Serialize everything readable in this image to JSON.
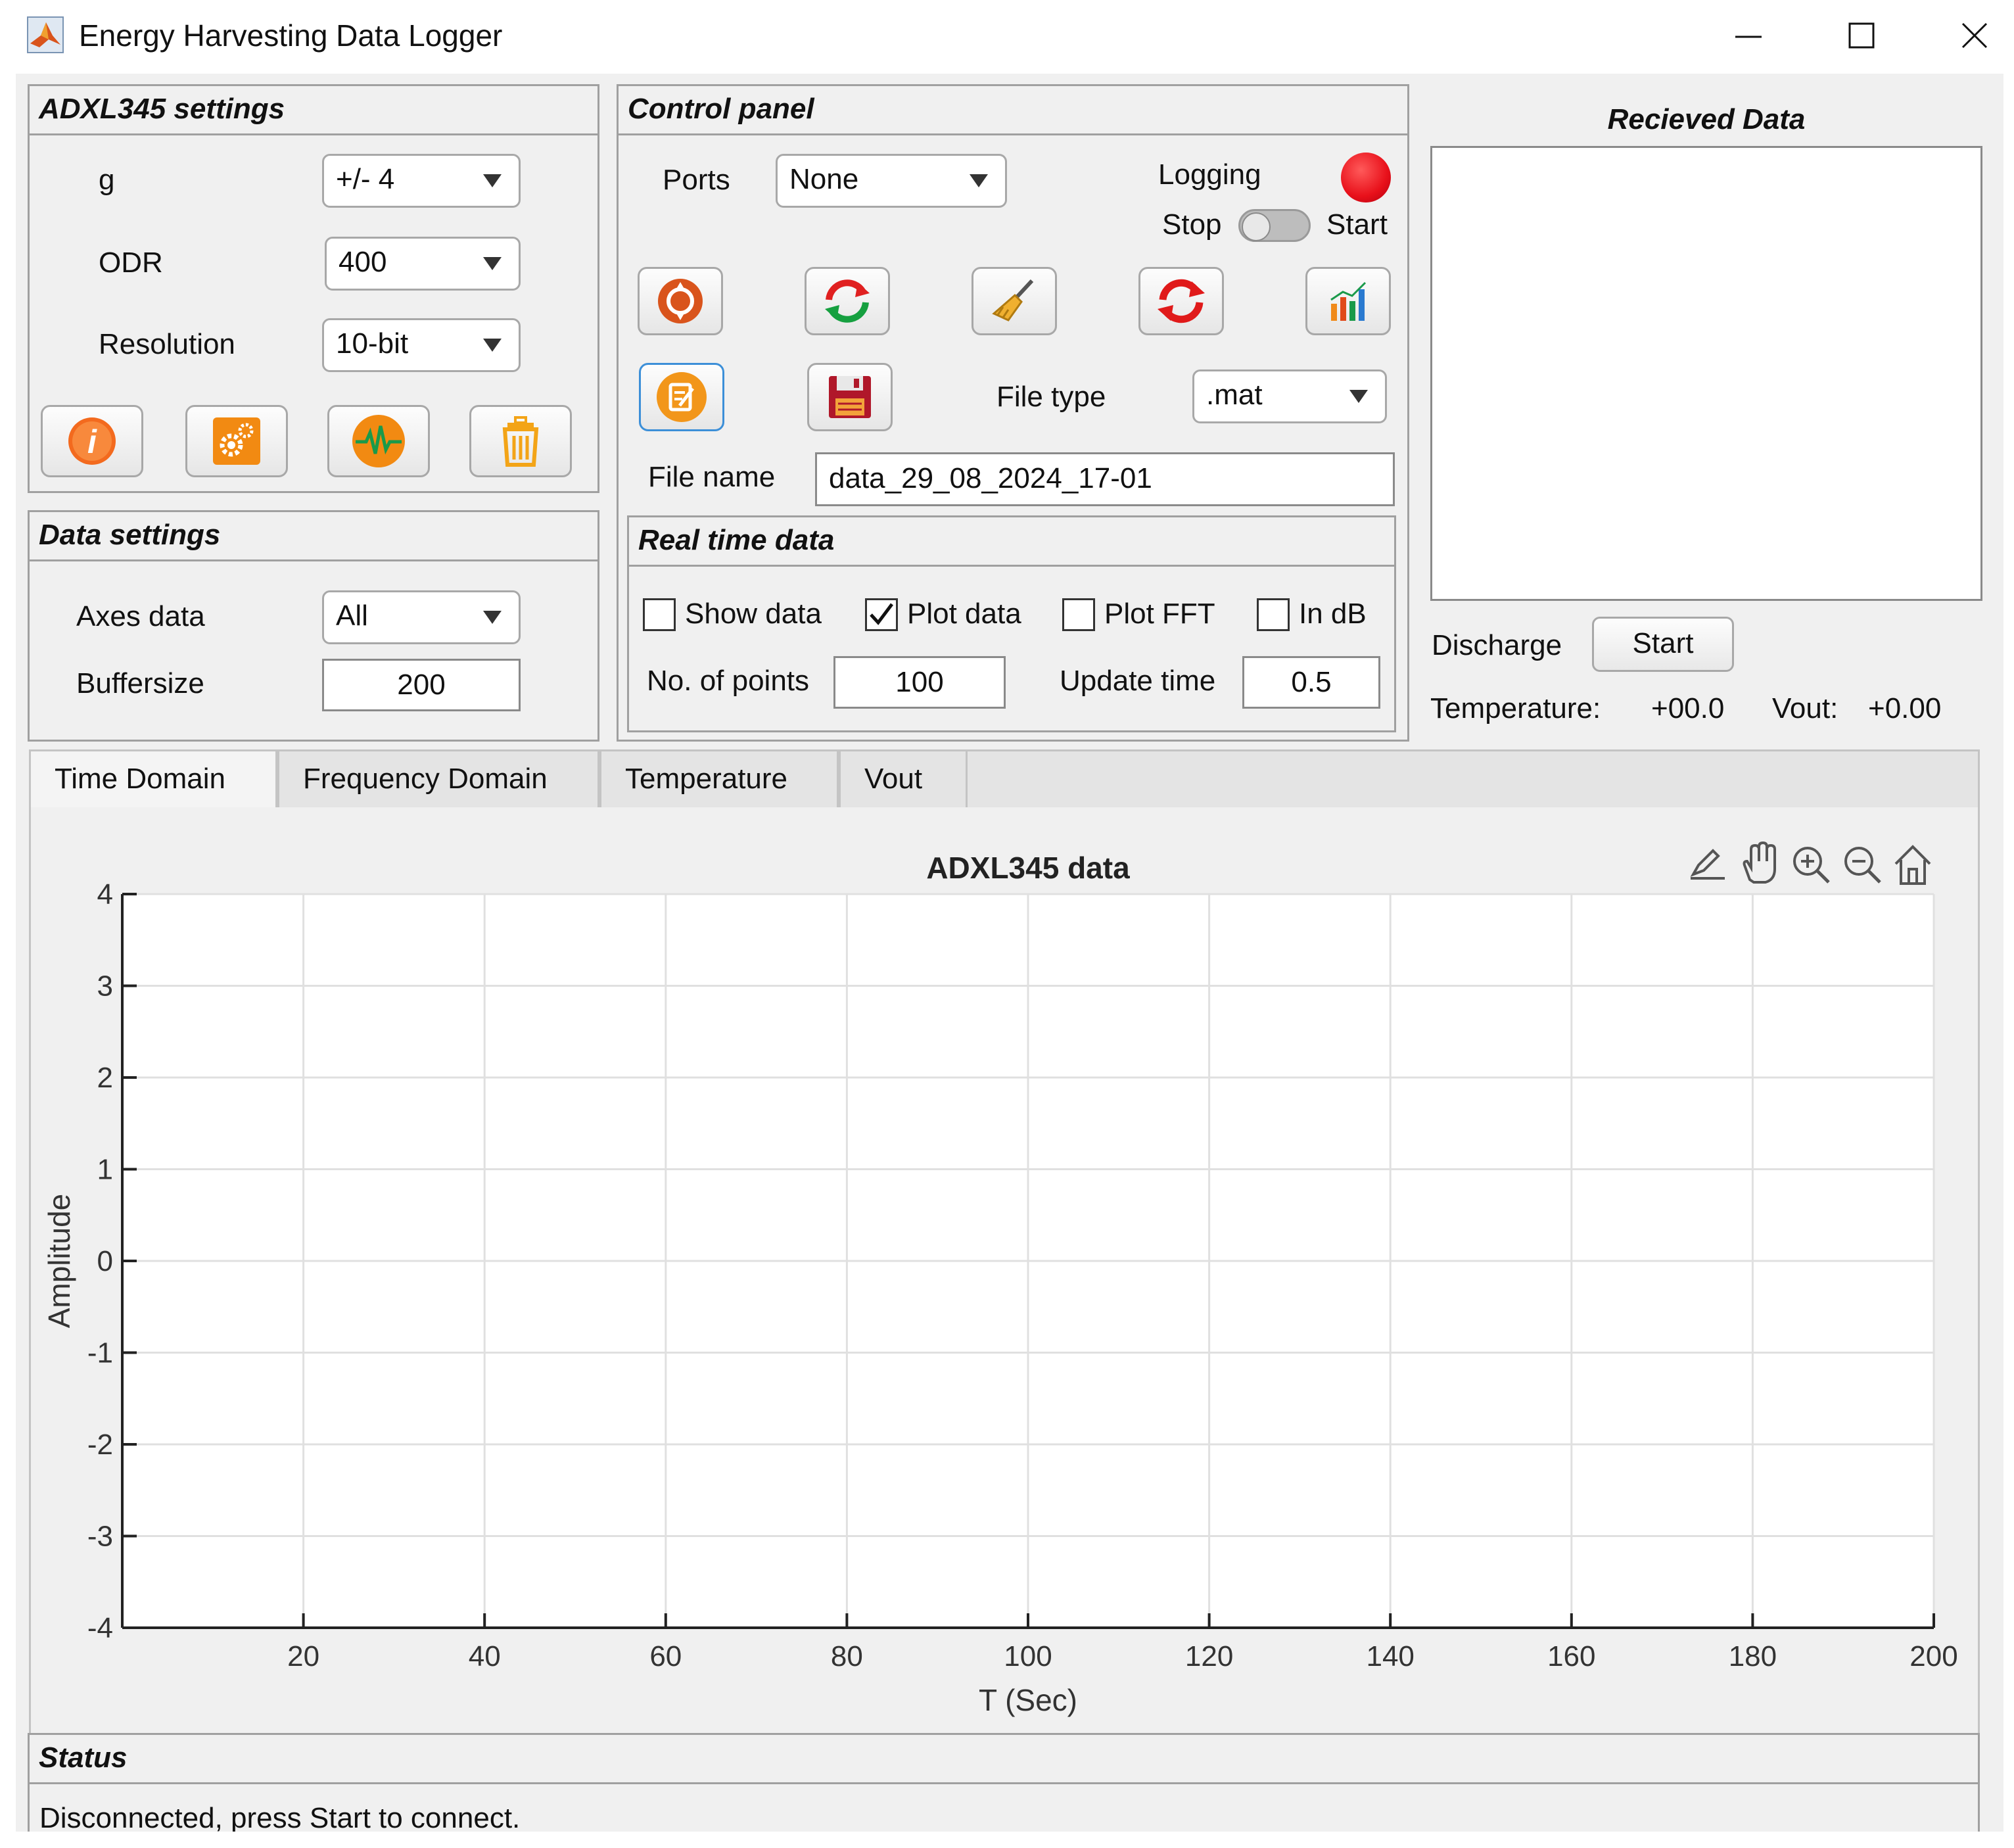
{
  "window": {
    "title": "Energy Harvesting Data Logger",
    "icon": "matlab-icon"
  },
  "adxl": {
    "title": "ADXL345 settings",
    "g_label": "g",
    "g_value": "+/- 4",
    "odr_label": "ODR",
    "odr_value": "400",
    "res_label": "Resolution",
    "res_value": "10-bit",
    "buttons": [
      "info-icon",
      "settings-gears-icon",
      "pulse-icon",
      "trash-icon"
    ]
  },
  "data_settings": {
    "title": "Data settings",
    "axes_label": "Axes data",
    "axes_value": "All",
    "buffer_label": "Buffersize",
    "buffer_value": "200"
  },
  "control": {
    "title": "Control panel",
    "ports_label": "Ports",
    "ports_value": "None",
    "logging_label": "Logging",
    "stop_label": "Stop",
    "start_label": "Start",
    "logging_lamp_color": "#e8101a",
    "file_type_label": "File type",
    "file_type_value": ".mat",
    "file_name_label": "File name",
    "file_name_value": "data_29_08_2024_17-01",
    "icons_row1": [
      "connect-icon",
      "refresh-green-icon",
      "broom-icon",
      "reset-red-icon",
      "bar-chart-icon"
    ],
    "icons_row2": [
      "edit-note-icon",
      "save-icon"
    ]
  },
  "realtime": {
    "title": "Real time data",
    "show_data": "Show data",
    "plot_data": "Plot data",
    "plot_fft": "Plot FFT",
    "in_db": "In dB",
    "points_label": "No. of points",
    "points_value": "100",
    "update_label": "Update time",
    "update_value": "0.5"
  },
  "received": {
    "title": "Recieved Data",
    "discharge_label": "Discharge",
    "discharge_button": "Start",
    "temp_label": "Temperature:",
    "temp_value": "+00.0",
    "vout_label": "Vout:",
    "vout_value": "+0.00"
  },
  "tabs": [
    "Time Domain",
    "Frequency Domain",
    "Temperature",
    "Vout"
  ],
  "status": {
    "title": "Status",
    "text": "Disconnected, press Start to connect."
  },
  "chart_data": {
    "type": "line",
    "title": "ADXL345 data",
    "xlabel": "T (Sec)",
    "ylabel": "Amplitude",
    "xlim": [
      0,
      200
    ],
    "ylim": [
      -4,
      4
    ],
    "xticks": [
      20,
      40,
      60,
      80,
      100,
      120,
      140,
      160,
      180,
      200
    ],
    "yticks": [
      4,
      3,
      2,
      1,
      0,
      -1,
      -2,
      -3,
      -4
    ],
    "grid": true,
    "series": []
  }
}
